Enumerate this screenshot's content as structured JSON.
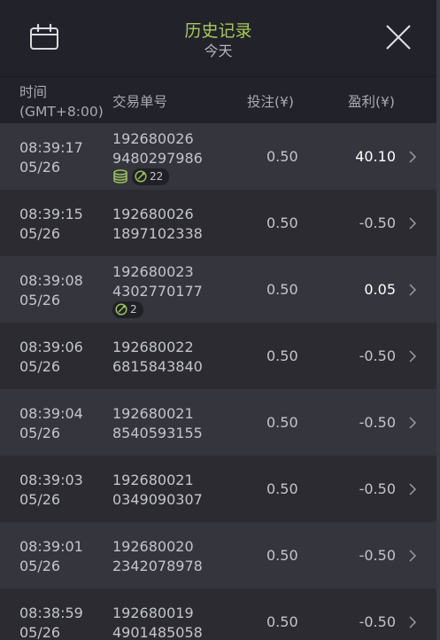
{
  "header": {
    "title": "历史记录",
    "subtitle": "今天"
  },
  "columns": {
    "time_line1": "时间",
    "time_line2": "(GMT+8:00)",
    "order": "交易单号",
    "bet": "投注(¥)",
    "profit": "盈利(¥)"
  },
  "rows": [
    {
      "time": "08:39:17",
      "date": "05/26",
      "order1": "192680026",
      "order2": "9480297986",
      "bet": "0.50",
      "profit": "40.10",
      "coin_badge": true,
      "ball_count": "22"
    },
    {
      "time": "08:39:15",
      "date": "05/26",
      "order1": "192680026",
      "order2": "1897102338",
      "bet": "0.50",
      "profit": "-0.50"
    },
    {
      "time": "08:39:08",
      "date": "05/26",
      "order1": "192680023",
      "order2": "4302770177",
      "bet": "0.50",
      "profit": "0.05",
      "ball_count": "2"
    },
    {
      "time": "08:39:06",
      "date": "05/26",
      "order1": "192680022",
      "order2": "6815843840",
      "bet": "0.50",
      "profit": "-0.50"
    },
    {
      "time": "08:39:04",
      "date": "05/26",
      "order1": "192680021",
      "order2": "8540593155",
      "bet": "0.50",
      "profit": "-0.50"
    },
    {
      "time": "08:39:03",
      "date": "05/26",
      "order1": "192680021",
      "order2": "0349090307",
      "bet": "0.50",
      "profit": "-0.50"
    },
    {
      "time": "08:39:01",
      "date": "05/26",
      "order1": "192680020",
      "order2": "2342078978",
      "bet": "0.50",
      "profit": "-0.50"
    },
    {
      "time": "08:38:59",
      "date": "05/26",
      "order1": "192680019",
      "order2": "4901485058",
      "bet": "0.50",
      "profit": "-0.50"
    }
  ],
  "colors": {
    "title": "#a8c85c",
    "background": "#2a2a30",
    "header": "#22222a",
    "row_odd": "#35353d",
    "row_even": "#2b2b31",
    "win": "#ffffff",
    "text": "#c4c4cc"
  },
  "icons": {
    "calendar": "calendar-icon",
    "close": "close-icon",
    "row_arrow": "chevron-right-icon",
    "coins": "coins-icon",
    "ball": "ball-icon"
  }
}
